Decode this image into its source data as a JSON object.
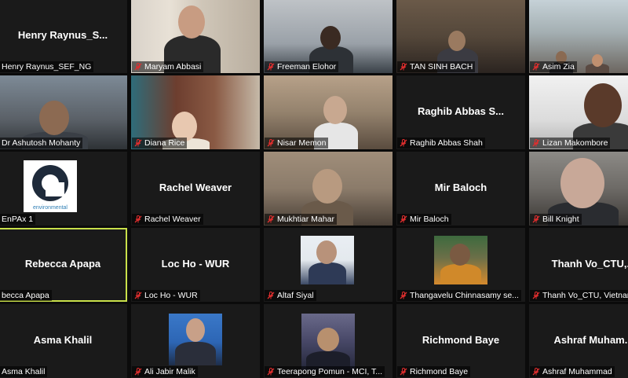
{
  "colors": {
    "background": "#0b0b0b",
    "tile": "#1a1a1a",
    "active_speaker_border": "#c9e04a",
    "muted_icon": "#e02e2e"
  },
  "participants": [
    {
      "label": "Henry Raynus_SEF_NG",
      "center_name": "Henry  Raynus_S...",
      "muted": false,
      "video": "none"
    },
    {
      "label": "Maryam Abbasi",
      "center_name": "",
      "muted": true,
      "video": "maryam"
    },
    {
      "label": "Freeman Elohor",
      "center_name": "",
      "muted": true,
      "video": "freeman"
    },
    {
      "label": "TAN SINH BACH",
      "center_name": "",
      "muted": true,
      "video": "tan"
    },
    {
      "label": "Asim Zia",
      "center_name": "",
      "muted": true,
      "video": "asim"
    },
    {
      "label": "Dr Ashutosh Mohanty",
      "center_name": "",
      "muted": false,
      "video": "ashutosh"
    },
    {
      "label": "Diana Rice",
      "center_name": "",
      "muted": true,
      "video": "diana"
    },
    {
      "label": "Nisar Memon",
      "center_name": "",
      "muted": true,
      "video": "nisar"
    },
    {
      "label": "Raghib Abbas Shah",
      "center_name": "Raghib  Abbas  S...",
      "muted": true,
      "video": "none"
    },
    {
      "label": "Lizan Makombore",
      "center_name": "",
      "muted": true,
      "video": "lizan"
    },
    {
      "label": "EnPAx 1",
      "center_name": "",
      "muted": false,
      "video": "logo",
      "logo_caption": "environmental"
    },
    {
      "label": "Rachel Weaver",
      "center_name": "Rachel Weaver",
      "muted": true,
      "video": "none"
    },
    {
      "label": "Mukhtiar Mahar",
      "center_name": "",
      "muted": true,
      "video": "mukhtiar"
    },
    {
      "label": "Mir Baloch",
      "center_name": "Mir Baloch",
      "muted": true,
      "video": "none"
    },
    {
      "label": "Bill Knight",
      "center_name": "",
      "muted": true,
      "video": "bill"
    },
    {
      "label": "becca Apapa",
      "center_name": "Rebecca Apapa",
      "muted": false,
      "video": "none",
      "active": true
    },
    {
      "label": "Loc Ho - WUR",
      "center_name": "Loc Ho - WUR",
      "muted": true,
      "video": "none"
    },
    {
      "label": "Altaf Siyal",
      "center_name": "",
      "muted": true,
      "video": "altaf"
    },
    {
      "label": "Thangavelu Chinnasamy se...",
      "center_name": "",
      "muted": true,
      "video": "thanga"
    },
    {
      "label": "Thanh Vo_CTU, Vietnam",
      "center_name": "Thanh  Vo_CTU,...",
      "muted": true,
      "video": "none"
    },
    {
      "label": "Asma Khalil",
      "center_name": "Asma Khalil",
      "muted": false,
      "video": "none"
    },
    {
      "label": "Ali Jabir Malik",
      "center_name": "",
      "muted": true,
      "video": "ali"
    },
    {
      "label": "Teerapong Pomun - MCI, T...",
      "center_name": "",
      "muted": true,
      "video": "teerapong"
    },
    {
      "label": "Richmond Baye",
      "center_name": "Richmond Baye",
      "muted": true,
      "video": "none"
    },
    {
      "label": "Ashraf Muhammad",
      "center_name": "Ashraf  Muham...",
      "muted": true,
      "video": "none"
    }
  ]
}
